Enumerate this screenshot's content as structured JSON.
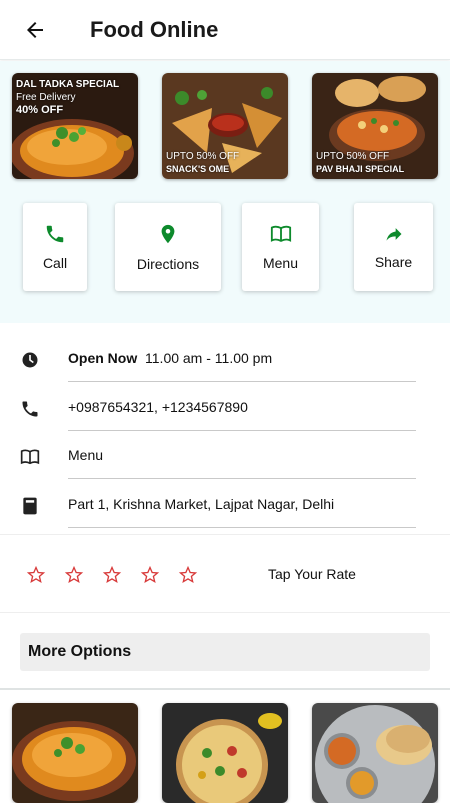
{
  "appbar": {
    "title": "Food Online"
  },
  "banners": [
    {
      "line1": "DAL TADKA SPECIAL",
      "line2": "Free Delivery",
      "line3": "40% OFF"
    },
    {
      "line1": "UPTO 50% OFF",
      "line2": "SNACK'S OME"
    },
    {
      "line1": "UPTO 50% OFF",
      "line2": "PAV BHAJI SPECIAL"
    }
  ],
  "actions": [
    {
      "label": "Call",
      "icon": "phone-icon"
    },
    {
      "label": "Directions",
      "icon": "location-pin-icon"
    },
    {
      "label": "Menu",
      "icon": "book-icon"
    },
    {
      "label": "Share",
      "icon": "share-arrow-icon"
    }
  ],
  "info": {
    "hours_label": "Open Now",
    "hours": "11.00 am - 11.00 pm",
    "phones": "+0987654321, +1234567890",
    "menu": "Menu",
    "address": "Part 1, Krishna Market, Lajpat Nagar, Delhi"
  },
  "rating": {
    "stars": 5,
    "selected": 0,
    "prompt": "Tap Your Rate"
  },
  "more_options": {
    "label": "More Options"
  },
  "colors": {
    "accent_green": "#0d8a2c",
    "star_red": "#d83a3a",
    "hero_bg": "#f1fbfc"
  }
}
